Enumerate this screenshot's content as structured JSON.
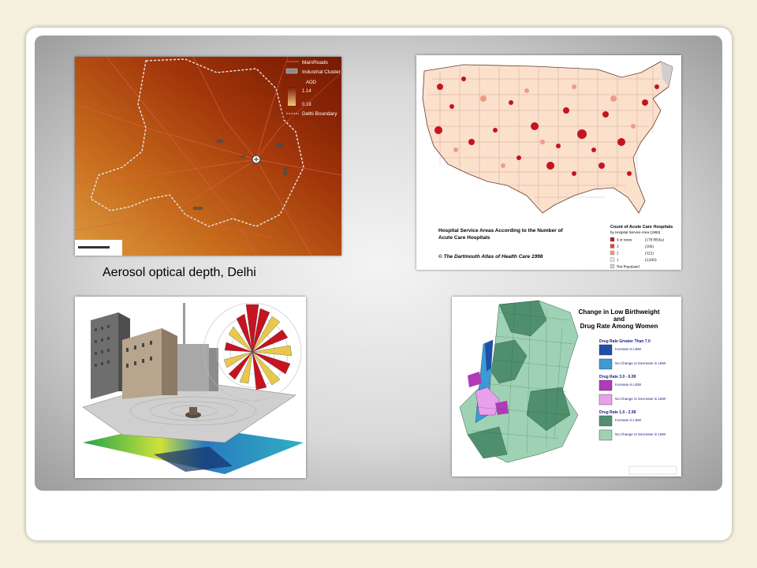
{
  "slide": {
    "caption": "Aerosol optical depth, Delhi"
  },
  "delhi_map": {
    "legend": {
      "main_roads": "MainRoads",
      "industrial_cluster": "Industrial Cluster",
      "aod_title": "AOD",
      "aod_high": "1.14",
      "aod_low": "0.18",
      "boundary": "Delhi Boundary"
    },
    "colors": {
      "dark": "#7a1a02",
      "mid": "#c0530e",
      "light": "#e8a24a"
    }
  },
  "us_map": {
    "title_line1": "Hospital Service Areas According to the Number of",
    "title_line2": "Acute Care Hospitals",
    "copyright": "© The Dartmouth Atlas of Health Care 1998",
    "legend_title": "Count of Acute Care Hospitals",
    "legend_subtitle": "by Hospital Service Area (1993)",
    "legend_items": [
      {
        "count": "4 or more",
        "n": "(178 HSAs)",
        "color": "#c4141f"
      },
      {
        "count": "3",
        "n": "(106)",
        "color": "#e0483c"
      },
      {
        "count": "2",
        "n": "(322)",
        "color": "#f09a86"
      },
      {
        "count": "1",
        "n": "(2,830)",
        "color": "#fbe0cc"
      },
      {
        "count": "Not Populated",
        "n": "",
        "color": "#cfcfcf"
      }
    ]
  },
  "nyc_map": {
    "title_line1": "Change in Low Birthweight",
    "title_line2": "and",
    "title_line3": "Drug Rate Among Women",
    "legend": [
      {
        "group": "Drug Rate Greater Than 7.0",
        "items": [
          {
            "label": "Increase in LBW",
            "color": "#1f4fa8"
          },
          {
            "label": "No Change or Decrease in LBW",
            "color": "#3d9ad6"
          }
        ]
      },
      {
        "group": "Drug Rate 3.0 - 6.99",
        "items": [
          {
            "label": "Increase in LBW",
            "color": "#b03ab8"
          },
          {
            "label": "No Change or Decrease in LBW",
            "color": "#e8a0ec"
          }
        ]
      },
      {
        "group": "Drug Rate 1.0 - 2.99",
        "items": [
          {
            "label": "Increase in LBW",
            "color": "#4f8f6e"
          },
          {
            "label": "No Change or Decrease in LBW",
            "color": "#9fd2b4"
          }
        ]
      }
    ]
  }
}
